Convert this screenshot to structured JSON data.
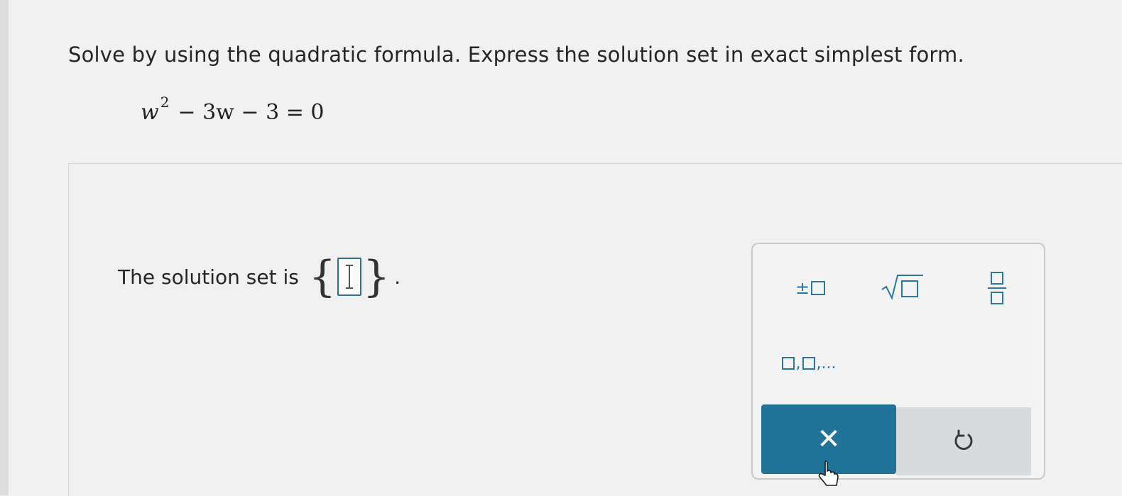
{
  "question": {
    "prompt": "Solve by using the quadratic formula. Express the solution set in exact simplest form.",
    "equation": {
      "variable": "w",
      "exponent": "2",
      "rest": "− 3w − 3 = 0"
    }
  },
  "answer": {
    "label": "The solution set is",
    "open_brace": "{",
    "close_brace": "}",
    "period": ".",
    "value": ""
  },
  "toolbox": {
    "plusminus_symbol": "±",
    "list_separator": ",",
    "list_ellipsis": ",...",
    "clear_symbol": "✕",
    "icons": [
      "plus-minus-icon",
      "square-root-icon",
      "fraction-icon",
      "list-icon",
      "close-icon",
      "undo-icon"
    ]
  },
  "colors": {
    "accent": "#2a77a7",
    "clear_button": "#1f7396",
    "undo_button": "#d7dbdd",
    "input_border": "#2f6f95"
  }
}
